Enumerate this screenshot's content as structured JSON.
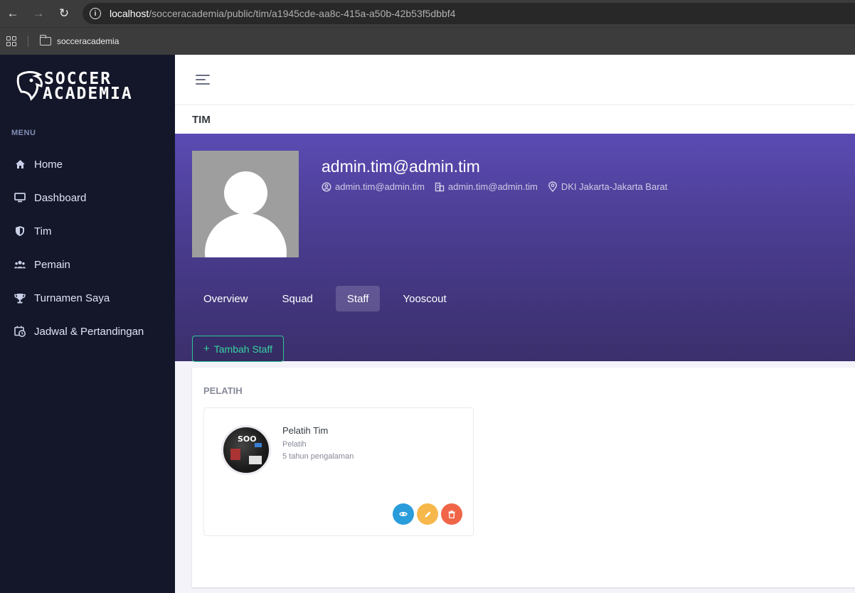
{
  "browser": {
    "url_host": "localhost",
    "url_path": "/socceracademia/public/tim/a1945cde-aa8c-415a-a50b-42b53f5dbbf4",
    "bookmark": "socceracademia"
  },
  "sidebar": {
    "logo_line1": "SOCCER",
    "logo_line2": "ACADEMIA",
    "menu_title": "MENU",
    "items": [
      {
        "label": "Home",
        "icon": "home-icon"
      },
      {
        "label": "Dashboard",
        "icon": "monitor-icon"
      },
      {
        "label": "Tim",
        "icon": "shield-icon"
      },
      {
        "label": "Pemain",
        "icon": "users-icon"
      },
      {
        "label": "Turnamen Saya",
        "icon": "trophy-icon"
      },
      {
        "label": "Jadwal & Pertandingan",
        "icon": "calendar-clock-icon"
      }
    ]
  },
  "page": {
    "title": "TIM"
  },
  "profile": {
    "name": "admin.tim@admin.tim",
    "meta": [
      {
        "icon": "user-pin-icon",
        "text": "admin.tim@admin.tim"
      },
      {
        "icon": "building-icon",
        "text": "admin.tim@admin.tim"
      },
      {
        "icon": "map-pin-icon",
        "text": "DKI Jakarta-Jakarta Barat"
      }
    ],
    "tabs": [
      "Overview",
      "Squad",
      "Staff",
      "Yooscout"
    ],
    "active_tab": "Staff",
    "add_button": "Tambah Staff"
  },
  "staff_section": {
    "title": "PELATIH",
    "members": [
      {
        "name": "Pelatih Tim",
        "role": "Pelatih",
        "experience": "5 tahun pengalaman"
      }
    ]
  },
  "colors": {
    "sidebar_bg": "#141729",
    "banner_top": "#5a4bb3",
    "banner_bottom": "#3b2f6c",
    "accent_green": "#36d3a0",
    "view_btn": "#299cdb",
    "edit_btn": "#f7b84b",
    "delete_btn": "#f06548"
  }
}
